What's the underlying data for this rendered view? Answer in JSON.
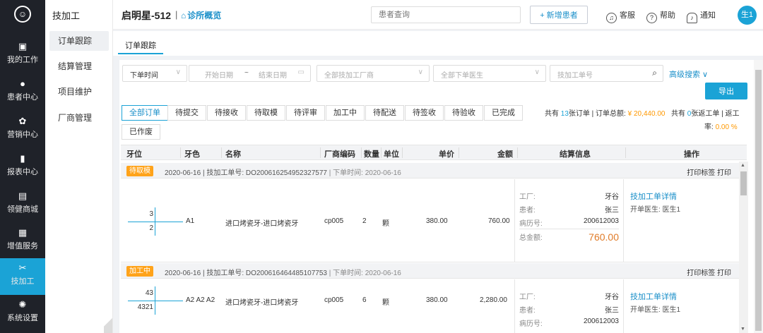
{
  "rail": {
    "logo": "☺",
    "items": [
      {
        "label": "我的工作",
        "icon": "chart-icon",
        "glyph": "▣"
      },
      {
        "label": "患者中心",
        "icon": "patient-icon",
        "glyph": "●"
      },
      {
        "label": "营销中心",
        "icon": "marketing-icon",
        "glyph": "✿"
      },
      {
        "label": "报表中心",
        "icon": "report-icon",
        "glyph": "▮"
      },
      {
        "label": "领健商城",
        "icon": "mall-icon",
        "glyph": "▤"
      },
      {
        "label": "增值服务",
        "icon": "value-added-icon",
        "glyph": "▦"
      },
      {
        "label": "技加工",
        "icon": "tools-icon",
        "glyph": "✂"
      },
      {
        "label": "系统设置",
        "icon": "settings-icon",
        "glyph": "✺"
      }
    ],
    "active_index": 6
  },
  "subnav": {
    "title": "技加工",
    "items": [
      "订单跟踪",
      "结算管理",
      "项目维护",
      "厂商管理"
    ]
  },
  "header": {
    "clinic": "启明星-512",
    "separator": "|",
    "overview": "诊所概览",
    "search_placeholder": "患者查询",
    "new_patient": "+ 新增患者",
    "service": "客服",
    "help": "帮助",
    "notify": "通知",
    "user": "生1"
  },
  "tabstrip": {
    "tab": "订单跟踪"
  },
  "filters": {
    "time_type": "下单时间",
    "start_date": "开始日期",
    "tilde": "~",
    "end_date": "结束日期",
    "vendor": "全部技加工厂商",
    "doctor": "全部下单医生",
    "order_no": "技加工单号",
    "advanced": "高级搜索 ∨",
    "export": "导出"
  },
  "status_tabs": [
    "全部订单",
    "待提交",
    "待接收",
    "待取模",
    "待评审",
    "加工中",
    "待配送",
    "待签收",
    "待验收",
    "已完成",
    "已作废"
  ],
  "summary": {
    "p1": "共有 ",
    "count": "13",
    "p2": "张订单 | 订单总额: ",
    "amount": "¥ 20,440.00",
    "p3": "共有 ",
    "return_count": "0",
    "p4": "张返工单 | 返工",
    "p5": "率: ",
    "rate": "0.00 %"
  },
  "table": {
    "headers": [
      "牙位",
      "牙色",
      "名称",
      "厂商编码",
      "数量",
      "单位",
      "单价",
      "金额",
      "结算信息",
      "操作"
    ]
  },
  "orders": [
    {
      "status": "待取模",
      "date": "2020-06-16",
      "order_no_label": "| 技加工单号: DO200616254952327577",
      "order_time": "| 下单时间: 2020-06-16",
      "actions": "打印标签  打印",
      "tooth_upper": "3",
      "tooth_lower": "2",
      "shade": "A1",
      "name": "进口烤瓷牙-进口烤瓷牙",
      "code": "cp005",
      "qty": "2",
      "unit": "颗",
      "price": "380.00",
      "amount": "760.00",
      "factory_label": "工厂:",
      "factory": "牙谷",
      "patient_label": "患者:",
      "patient": "张三",
      "record_label": "病历号:",
      "record": "200612003",
      "total_label": "总金额:",
      "total": "760.00",
      "detail_link": "技加工单详情",
      "doctor": "开单医生: 医生1"
    },
    {
      "status": "加工中",
      "date": "2020-06-16",
      "order_no_label": "| 技加工单号: DO200616464485107753",
      "order_time": "| 下单时间: 2020-06-16",
      "actions": "打印标签  打印",
      "tooth_upper": "43",
      "tooth_lower": "4321",
      "shade": "A2 A2 A2",
      "name": "进口烤瓷牙-进口烤瓷牙",
      "code": "cp005",
      "qty": "6",
      "unit": "颗",
      "price": "380.00",
      "amount": "2,280.00",
      "factory_label": "工厂:",
      "factory": "牙谷",
      "patient_label": "患者:",
      "patient": "张三",
      "record_label": "病历号:",
      "record": "200612003",
      "detail_link": "技加工单详情",
      "doctor": "开单医生: 医生1"
    }
  ],
  "colors": {
    "accent": "#1ba3d6",
    "badge": "#ffa31a",
    "sidebar": "#1f2229",
    "total": "#e07b28"
  }
}
